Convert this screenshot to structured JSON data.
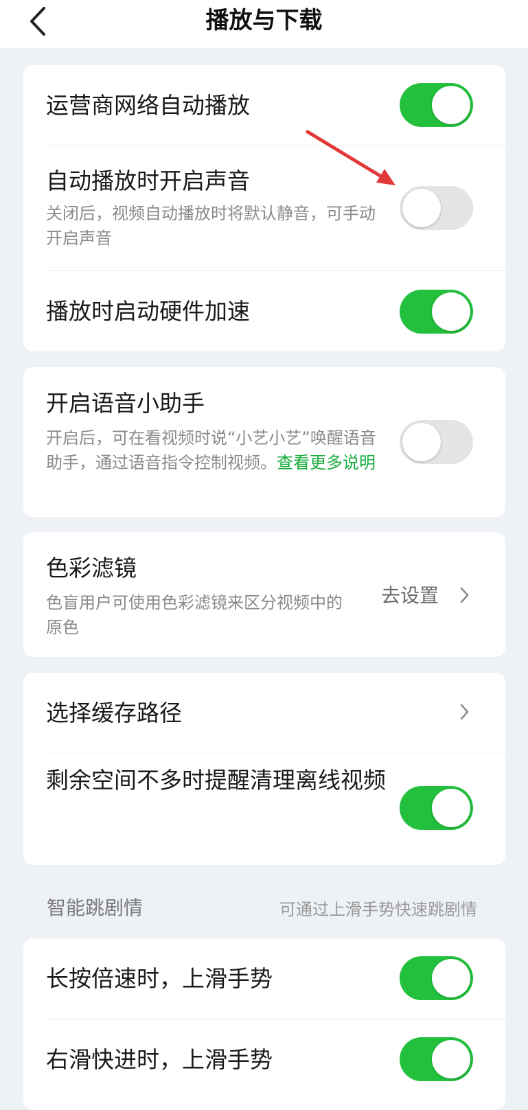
{
  "header": {
    "title": "播放与下载"
  },
  "cards": {
    "playback": {
      "carrier_autoplay": {
        "title": "运营商网络自动播放",
        "state": "on"
      },
      "autoplay_sound": {
        "title": "自动播放时开启声音",
        "desc": "关闭后，视频自动播放时将默认静音，可手动开启声音",
        "state": "off"
      },
      "hw_accel": {
        "title": "播放时启动硬件加速",
        "state": "on"
      }
    },
    "voice_assistant": {
      "title": "开启语音小助手",
      "desc": "开启后，可在看视频时说“小艺小艺”唤醒语音助手，通过语音指令控制视频。",
      "link": "查看更多说明",
      "state": "off"
    },
    "color_filter": {
      "title": "色彩滤镜",
      "desc": "色盲用户可使用色彩滤镜来区分视频中的原色",
      "action": "去设置"
    },
    "storage": {
      "cache_path": {
        "title": "选择缓存路径"
      },
      "low_space_reminder": {
        "title": "剩余空间不多时提醒清理离线视频",
        "state": "on"
      }
    }
  },
  "smart_skip": {
    "label": "智能跳剧情",
    "hint": "可通过上滑手势快速跳剧情",
    "long_press": {
      "title": "长按倍速时，上滑手势",
      "state": "on"
    },
    "swipe_right": {
      "title": "右滑快进时，上滑手势",
      "state": "on"
    }
  },
  "colors": {
    "toggle_on": "#22c03c",
    "toggle_off": "#e4e4e4",
    "link": "#1aad3e",
    "annotation_arrow": "#e0393a"
  },
  "icons": {
    "back": "back-chevron-icon",
    "chevron": "chevron-right-icon"
  }
}
